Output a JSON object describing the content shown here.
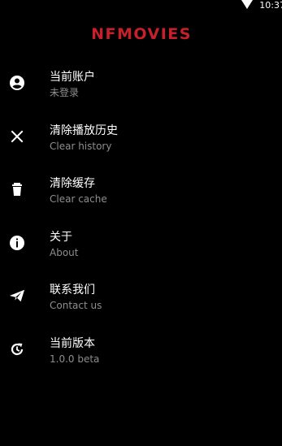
{
  "status_bar": {
    "time": "10:37",
    "wifi_icon": "wifi-icon"
  },
  "app": {
    "logo_text": "NFMOVIES",
    "brand_color": "#c8202b"
  },
  "menu": {
    "items": [
      {
        "id": "account",
        "icon": "account-circle-icon",
        "title": "当前账户",
        "subtitle": "未登录"
      },
      {
        "id": "clear-history",
        "icon": "close-icon",
        "title": "清除播放历史",
        "subtitle": "Clear history"
      },
      {
        "id": "clear-cache",
        "icon": "trash-icon",
        "title": "清除缓存",
        "subtitle": "Clear cache"
      },
      {
        "id": "about",
        "icon": "info-icon",
        "title": "关于",
        "subtitle": "About"
      },
      {
        "id": "contact",
        "icon": "send-icon",
        "title": "联系我们",
        "subtitle": "Contact us"
      },
      {
        "id": "version",
        "icon": "update-icon",
        "title": "当前版本",
        "subtitle": "1.0.0 beta"
      }
    ]
  },
  "colors": {
    "background": "#000000",
    "text": "#ffffff",
    "subtext": "#8e8e8e"
  }
}
